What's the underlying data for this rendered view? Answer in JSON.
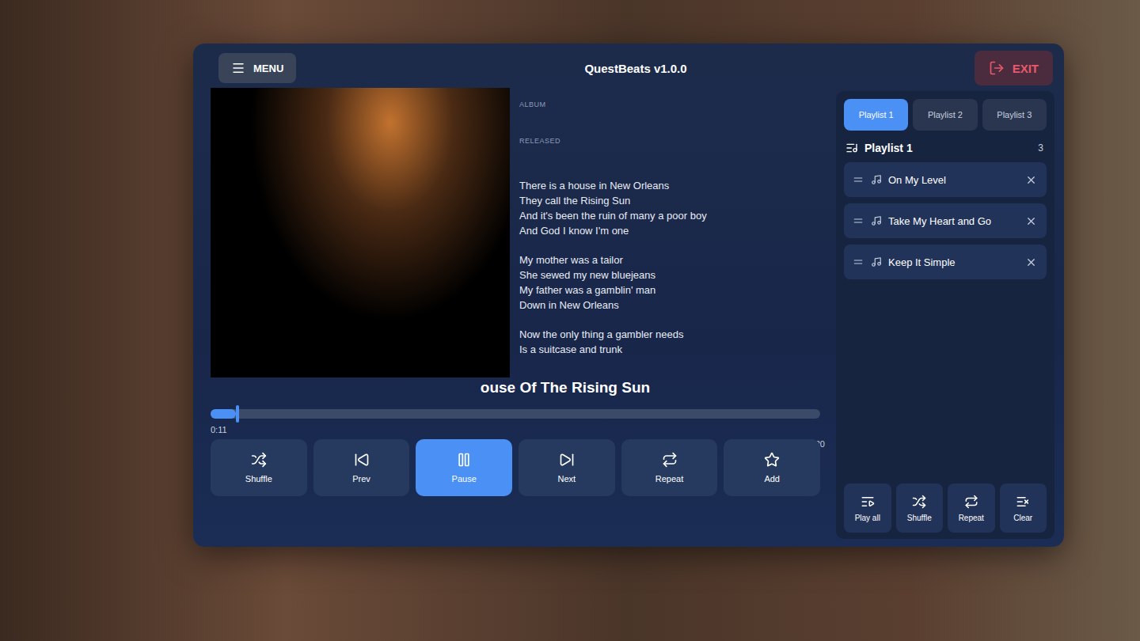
{
  "window": {
    "title": "QuestBeats v1.0.0",
    "menu": "MENU",
    "exit": "EXIT"
  },
  "track": {
    "album_label": "ALBUM",
    "released_label": "RELEASED",
    "title": "ouse Of The Rising Sun",
    "elapsed": "0:11",
    "duration": "4:20",
    "level": 0.042,
    "playing": true
  },
  "lyrics": [
    [
      "There is a house in New Orleans",
      "They call the Rising Sun",
      "And it's been the ruin of many a poor boy",
      "And God I know I'm one"
    ],
    [
      "My mother was a tailor",
      "She sewed my new bluejeans",
      "My father was a gamblin' man",
      "Down in New Orleans"
    ],
    [
      "Now the only thing a gambler needs",
      "Is a suitcase and trunk"
    ]
  ],
  "controls": [
    {
      "label": "Shuffle",
      "selected": false
    },
    {
      "label": "Prev",
      "selected": false
    },
    {
      "label": "Pause",
      "selected": true
    },
    {
      "label": "Next",
      "selected": false
    },
    {
      "label": "Repeat",
      "selected": false
    },
    {
      "label": "Add",
      "selected": false
    }
  ],
  "playlist_tabs": [
    {
      "label": "Playlist 1",
      "selected": true
    },
    {
      "label": "Playlist 2",
      "selected": false
    },
    {
      "label": "Playlist 3",
      "selected": false
    }
  ],
  "playlist": {
    "title": "Playlist 1",
    "count": "3",
    "items": [
      "On My Level",
      "Take My Heart and Go",
      "Keep It Simple"
    ]
  },
  "playlist_actions": [
    "Play all",
    "Shuffle",
    "Repeat",
    "Clear"
  ]
}
